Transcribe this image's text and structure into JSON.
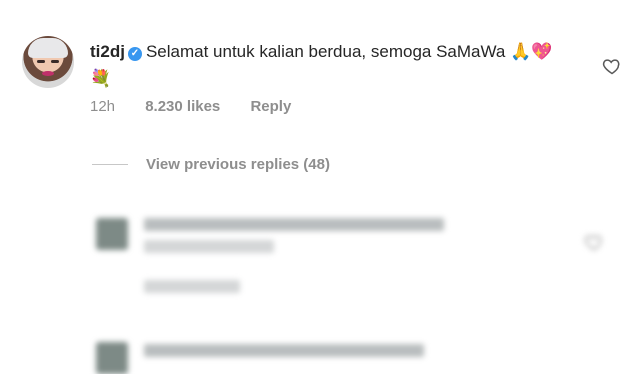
{
  "comment": {
    "username": "ti2dj",
    "text": "Selamat untuk kalian berdua, semoga SaMaWa 🙏💖💐",
    "time": "12h",
    "likes": "8.230 likes",
    "reply_label": "Reply"
  },
  "replies": {
    "view_previous_label": "View previous replies (48)"
  },
  "icons": {
    "verified": "verified-badge-icon",
    "like": "heart-outline-icon"
  },
  "colors": {
    "text": "#262626",
    "muted": "#8e8e8e",
    "verified": "#3897f0"
  }
}
